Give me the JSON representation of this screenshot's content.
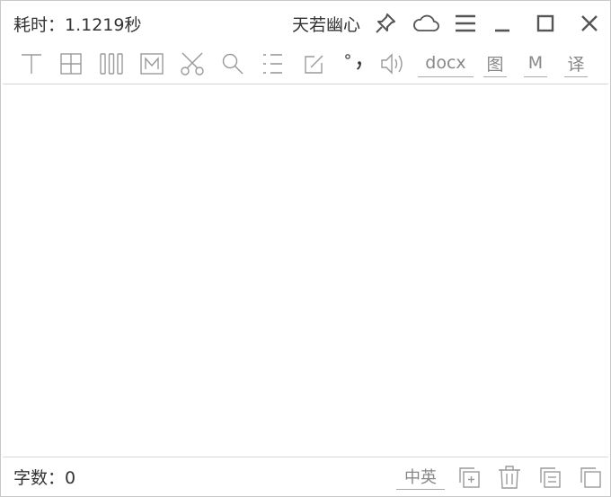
{
  "title_bar": {
    "elapsed_label": "耗时：1.1219秒",
    "window_title": "天若幽心",
    "buttons": [
      {
        "name": "pin-icon"
      },
      {
        "name": "cloud-icon"
      },
      {
        "name": "menu-icon"
      },
      {
        "name": "minimize-icon"
      },
      {
        "name": "maximize-icon"
      },
      {
        "name": "close-icon"
      }
    ]
  },
  "toolbar": {
    "tools": [
      {
        "name": "text-align-top-icon"
      },
      {
        "name": "table-grid-icon"
      },
      {
        "name": "vertical-columns-icon"
      },
      {
        "name": "markdown-icon"
      },
      {
        "name": "scissors-icon"
      },
      {
        "name": "search-icon"
      },
      {
        "name": "list-icon"
      },
      {
        "name": "edit-icon"
      },
      {
        "name": "punctuation-icon"
      },
      {
        "name": "speaker-icon"
      }
    ],
    "text_buttons": {
      "docx_label": "docx",
      "image_label": "图",
      "m_label": "M",
      "translate_label": "译"
    }
  },
  "content": {
    "text": ""
  },
  "status_bar": {
    "word_count_label": "字数：0",
    "language_toggle_label": "中英",
    "buttons": [
      {
        "name": "add-copy-icon"
      },
      {
        "name": "trash-icon"
      },
      {
        "name": "merge-icon"
      },
      {
        "name": "copy-icon"
      }
    ]
  },
  "colors": {
    "icon_gray": "#888888",
    "text_dark": "#333333",
    "border": "#c8c8c8"
  }
}
